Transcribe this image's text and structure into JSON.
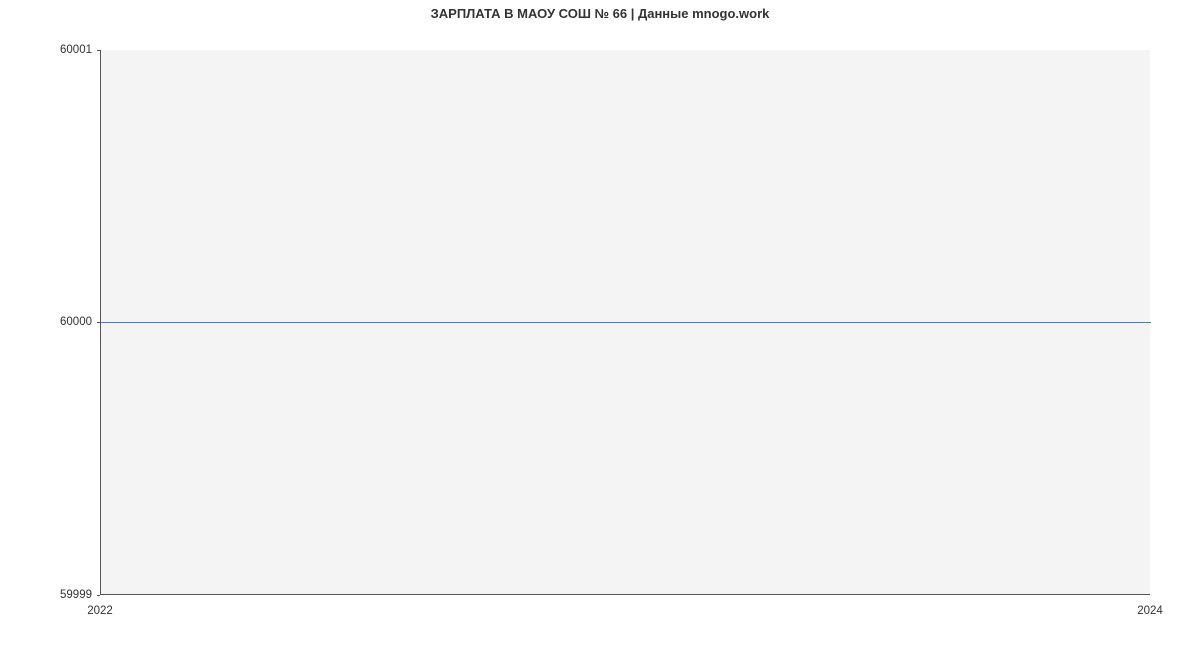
{
  "chart_data": {
    "type": "line",
    "title": "ЗАРПЛАТА В МАОУ СОШ № 66 | Данные mnogo.work",
    "xlabel": "",
    "ylabel": "",
    "x": [
      2022,
      2024
    ],
    "values": [
      60000,
      60000
    ],
    "xlim": [
      2022,
      2024
    ],
    "ylim": [
      59999,
      60001
    ],
    "x_ticks": [
      2022,
      2024
    ],
    "y_ticks": [
      59999,
      60000,
      60001
    ],
    "line_color": "#3b7dd8",
    "plot_bg": "#f4f4f4"
  }
}
